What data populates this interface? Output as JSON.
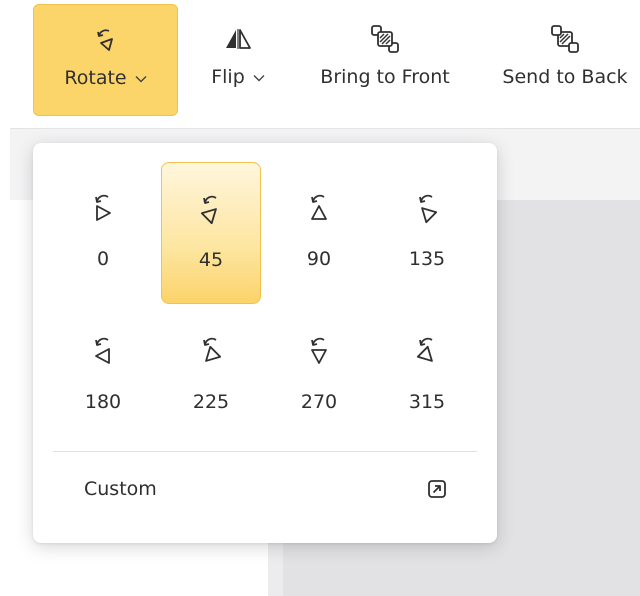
{
  "toolbar": {
    "rotate": {
      "label": "Rotate",
      "icon": "rotate-icon",
      "active": true
    },
    "flip": {
      "label": "Flip",
      "icon": "flip-icon"
    },
    "bring_to_front": {
      "label": "Bring to Front",
      "icon": "bring-to-front-icon"
    },
    "send_to_back": {
      "label": "Send to Back",
      "icon": "send-to-back-icon"
    }
  },
  "rotate_menu": {
    "options": [
      {
        "label": "0",
        "angle": 0
      },
      {
        "label": "45",
        "angle": 45,
        "selected": true
      },
      {
        "label": "90",
        "angle": 90
      },
      {
        "label": "135",
        "angle": 135
      },
      {
        "label": "180",
        "angle": 180
      },
      {
        "label": "225",
        "angle": 225
      },
      {
        "label": "270",
        "angle": 270
      },
      {
        "label": "315",
        "angle": 315
      }
    ],
    "custom_label": "Custom",
    "custom_icon": "open-external-icon"
  },
  "colors": {
    "accent": "#fbd46a",
    "accent_border": "#f1c24a",
    "text": "#2f2f2f"
  }
}
